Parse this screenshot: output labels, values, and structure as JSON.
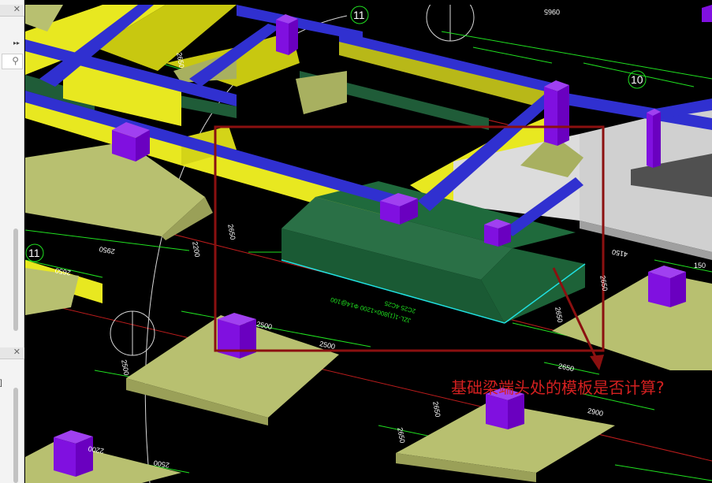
{
  "viewport": {
    "axis_labels": [
      "11",
      "10",
      "11"
    ],
    "dimensions": [
      "0965",
      "2650",
      "2950",
      "2650",
      "2650",
      "2500",
      "2500",
      "2500",
      "2650",
      "2650",
      "4150",
      "2650",
      "2650",
      "2650",
      "2900",
      "2500",
      "2200",
      "2200",
      "150"
    ],
    "beam_tag": "JZL-1(1)800×1200 Φ14@100",
    "beam_tag_2": "2C25 4C25"
  },
  "annotation": {
    "text": "基础梁端头处的模板是否计算?",
    "color": "#d42020"
  },
  "colors": {
    "beam_blue": "#3030d0",
    "column_purple": "#8a10e0",
    "wall_yellow": "#e8e820",
    "footing_olive": "#b8c070",
    "beam_green": "#1f5c38",
    "highlight_box": "#8b1010",
    "dim_line": "#20e020"
  }
}
